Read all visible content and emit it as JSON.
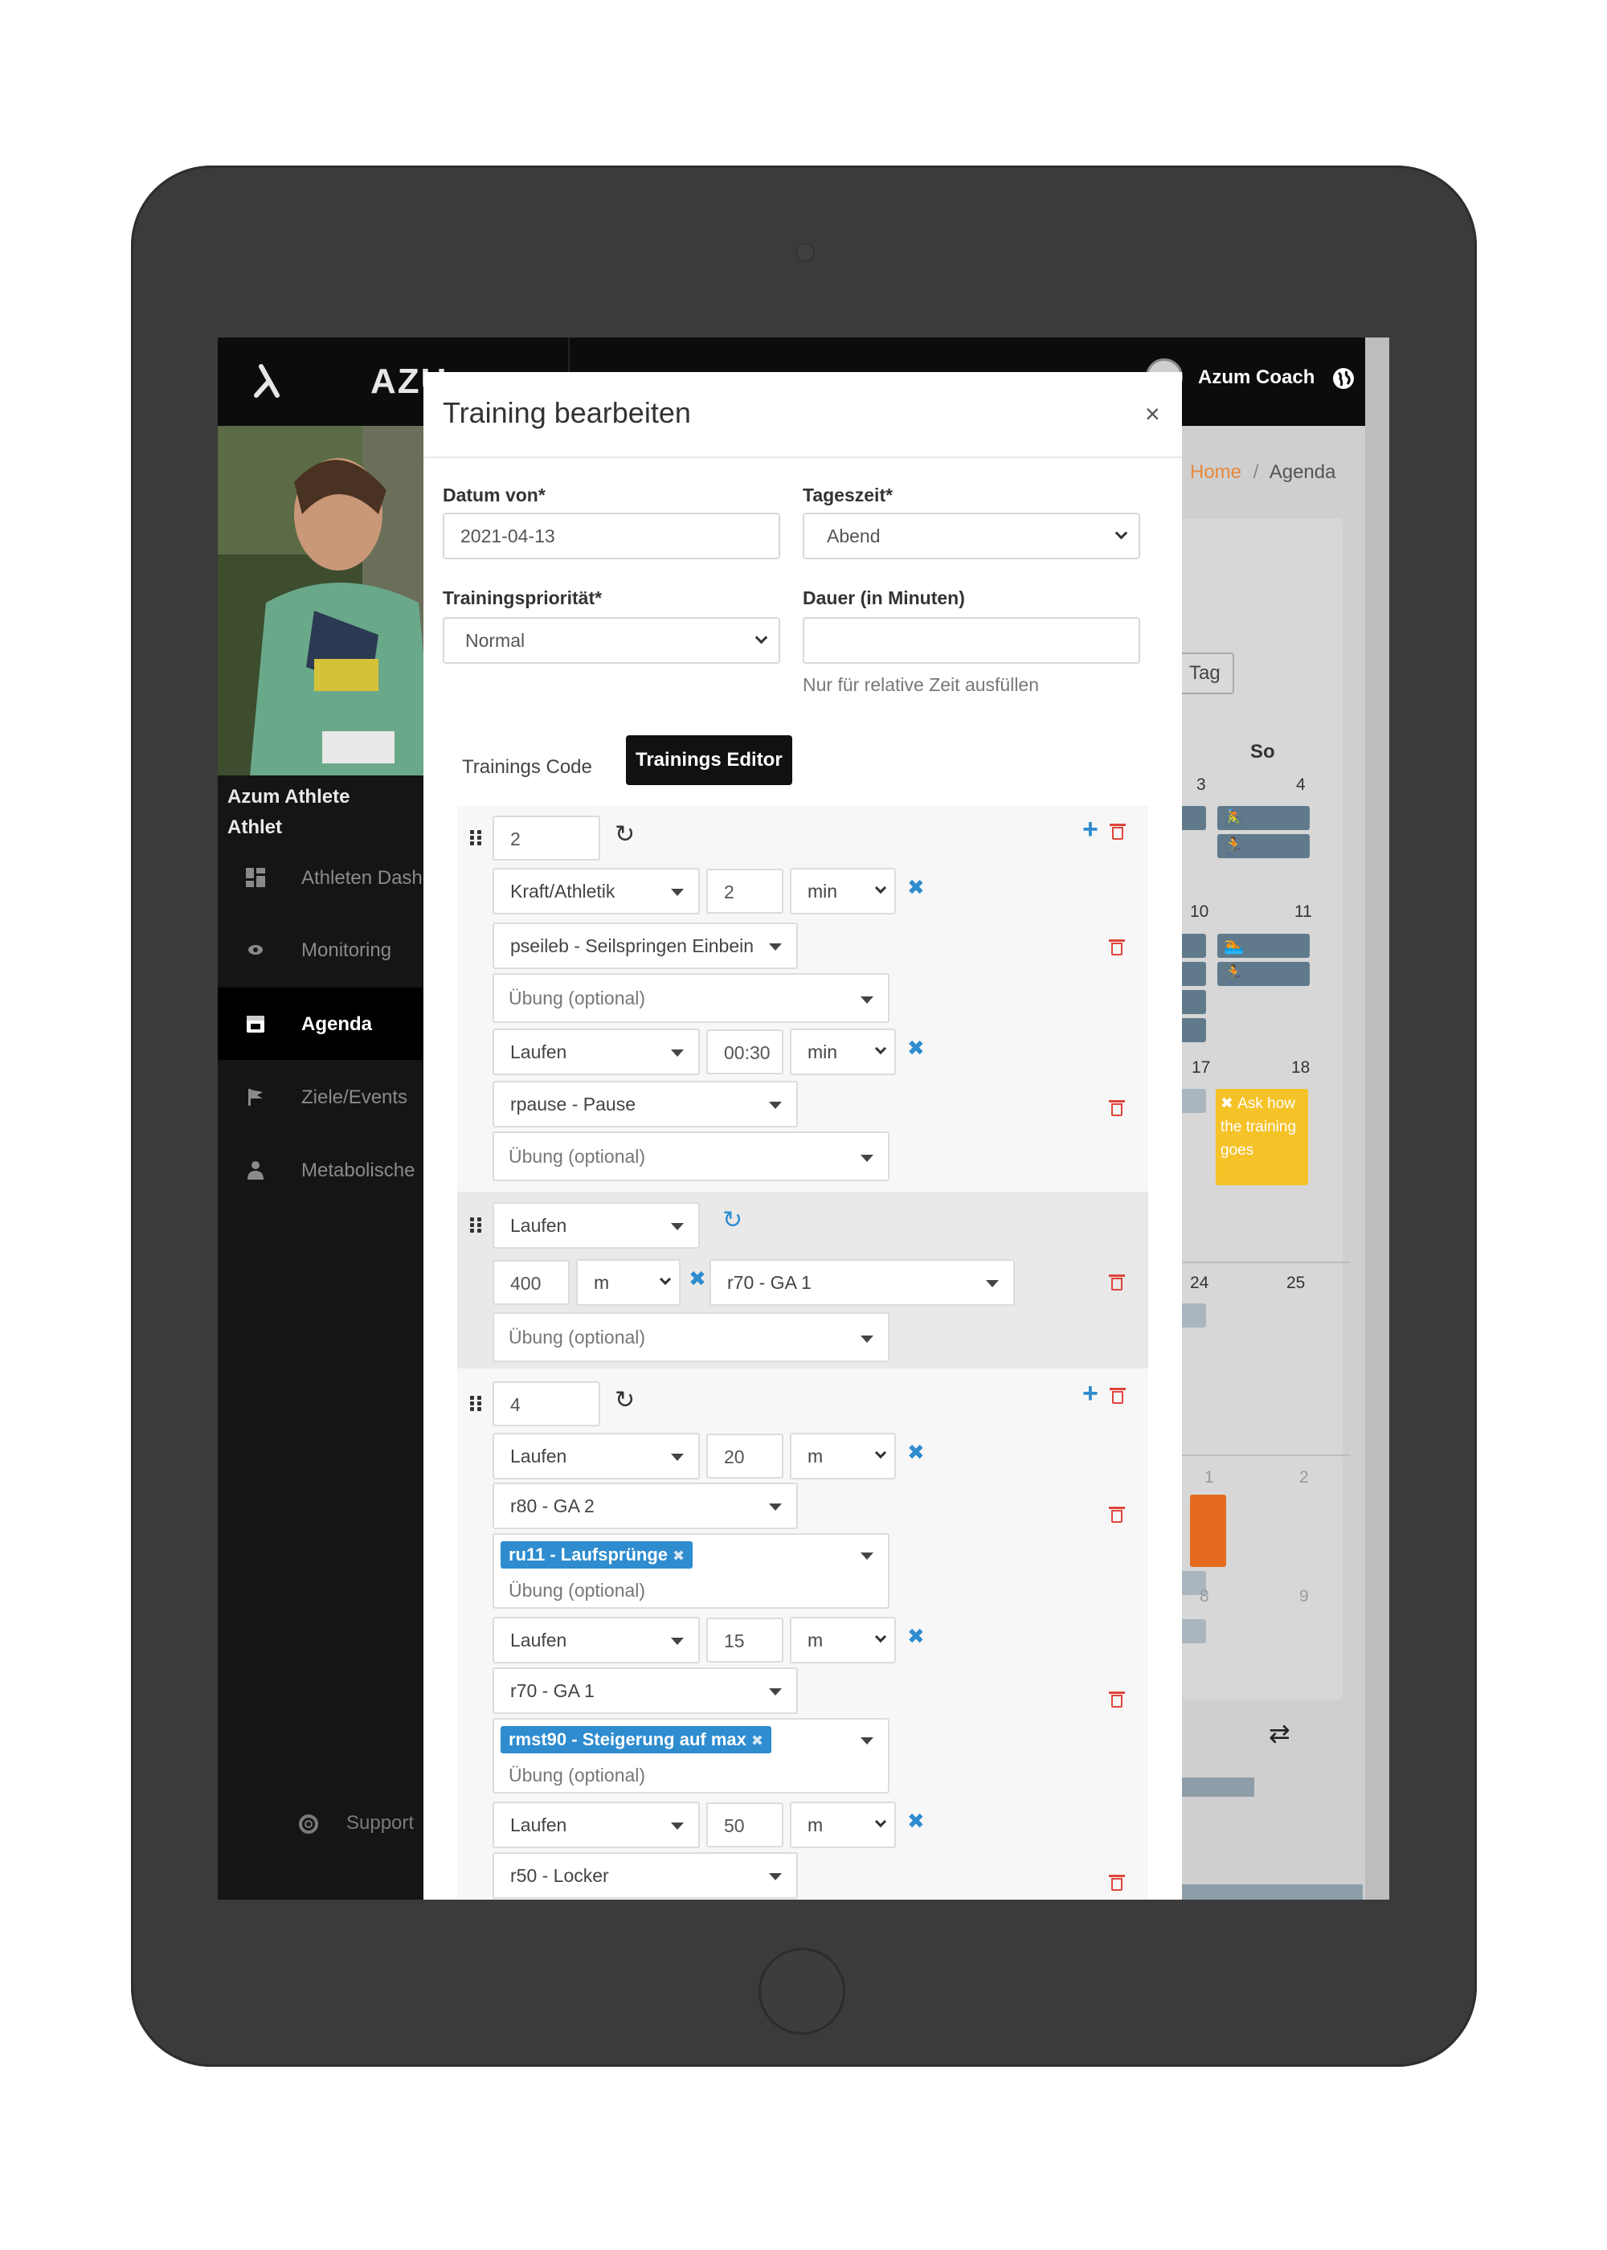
{
  "app": {
    "logo_text": "AZU",
    "user_name": "Azum Coach"
  },
  "sidebar": {
    "athlete_name": "Azum Athlete",
    "athlete_role": "Athlet",
    "items": [
      {
        "label": "Athleten Dashboard",
        "icon": "dashboard-icon"
      },
      {
        "label": "Monitoring",
        "icon": "eye-icon"
      },
      {
        "label": "Agenda",
        "icon": "calendar-icon"
      },
      {
        "label": "Ziele/Events",
        "icon": "flag-icon"
      },
      {
        "label": "Metabolische",
        "icon": "person-icon"
      }
    ],
    "support_label": "Support"
  },
  "background": {
    "breadcrumb_home": "Home",
    "breadcrumb_sep": "/",
    "breadcrumb_current": "Agenda",
    "tag_button": "Tag",
    "day_header": "So",
    "numbers": [
      "3",
      "4",
      "10",
      "11",
      "17",
      "18",
      "24",
      "25",
      "1",
      "2",
      "8",
      "9"
    ],
    "yellow_event": "Ask how the training goes"
  },
  "modal": {
    "title": "Training bearbeiten",
    "close_label": "×",
    "date_from_label": "Datum von*",
    "date_from_value": "2021-04-13",
    "daytime_label": "Tageszeit*",
    "daytime_value": "Abend",
    "priority_label": "Trainingspriorität*",
    "priority_value": "Normal",
    "duration_label": "Dauer (in Minuten)",
    "duration_value": "",
    "duration_hint": "Nur für relative Zeit ausfüllen",
    "tabs": {
      "code": "Trainings Code",
      "editor": "Trainings Editor"
    }
  },
  "editor": {
    "optional_placeholder": "Übung (optional)",
    "block1": {
      "repeat": "2",
      "rows": [
        {
          "sport": "Laufen",
          "amount": "",
          "unit": "",
          "exercise": "",
          "tag": ""
        },
        {
          "sport": "Kraft/Athletik",
          "amount": "2",
          "unit": "min",
          "exercise": "pseileb - Seilspringen Einbein",
          "tag": ""
        },
        {
          "sport": "Laufen",
          "amount": "00:30",
          "unit": "min",
          "exercise": "rpause - Pause",
          "tag": ""
        }
      ]
    },
    "block2": {
      "sport": "Laufen",
      "amount": "400",
      "unit": "m",
      "exercise": "r70 - GA 1"
    },
    "block3": {
      "repeat": "4",
      "rows": [
        {
          "sport": "Laufen",
          "amount": "20",
          "unit": "m",
          "exercise": "r80 - GA 2",
          "tag": "ru11 - Laufsprünge"
        },
        {
          "sport": "Laufen",
          "amount": "15",
          "unit": "m",
          "exercise": "r70 - GA 1",
          "tag": "rmst90 - Steigerung auf max"
        },
        {
          "sport": "Laufen",
          "amount": "50",
          "unit": "m",
          "exercise": "r50 - Locker",
          "tag": ""
        }
      ]
    }
  },
  "colors": {
    "accent_blue": "#2e8ccf",
    "danger_red": "#e0453a",
    "brand_orange": "#e8883a",
    "event_yellow": "#f5c228"
  }
}
